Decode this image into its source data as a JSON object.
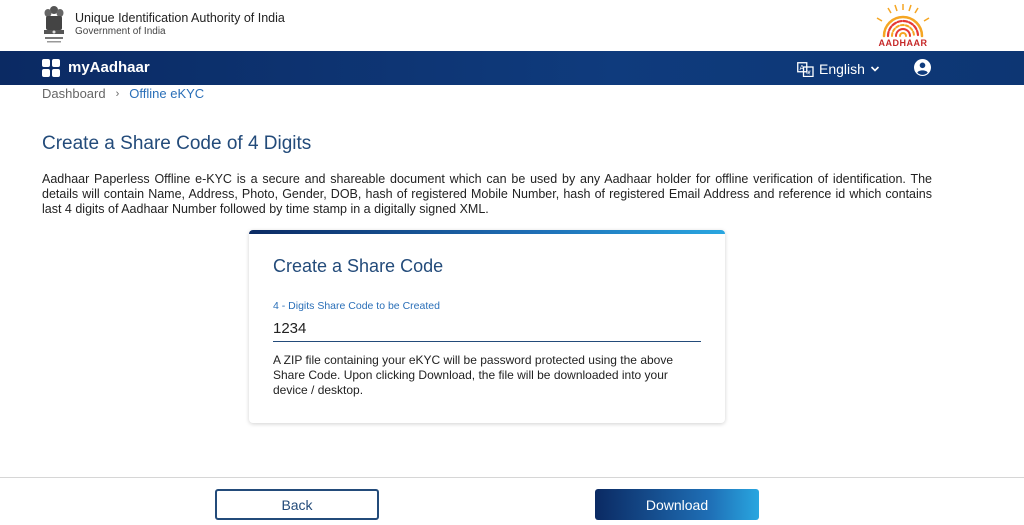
{
  "gov_header": {
    "title": "Unique Identification Authority of India",
    "subtitle": "Government of India",
    "emblem_icon": "national-emblem-icon",
    "logo_icon": "aadhaar-logo-icon",
    "logo_text": "AADHAAR"
  },
  "navbar": {
    "brand": "myAadhaar",
    "brand_icon": "grid-apps-icon",
    "language": "English",
    "language_icon": "translate-icon",
    "user_icon": "user-account-icon"
  },
  "breadcrumb": {
    "items": [
      "Dashboard",
      "Offline eKYC"
    ],
    "separator": "›"
  },
  "main": {
    "title": "Create a Share Code of 4 Digits",
    "description": "Aadhaar Paperless Offline e-KYC is a secure and shareable document which can be used by any Aadhaar holder for offline verification of identification. The details will contain Name, Address, Photo, Gender, DOB, hash of registered Mobile Number, hash of registered Email Address and reference id which contains last 4 digits of Aadhaar Number followed by time stamp in a digitally signed XML."
  },
  "card": {
    "title": "Create a Share Code",
    "field_label": "4 - Digits Share Code to be Created",
    "field_value": "1234",
    "help_text": "A ZIP file containing your eKYC will be password protected using the above Share Code. Upon clicking Download, the file will be downloaded into your device / desktop."
  },
  "footer": {
    "back_label": "Back",
    "download_label": "Download"
  },
  "colors": {
    "navy": "#0b2a63",
    "primary_blue": "#234b7a",
    "link_blue": "#2a6fb8",
    "accent_cyan": "#29a6e0",
    "aadhaar_red": "#c62828",
    "aadhaar_orange": "#f5a623"
  }
}
